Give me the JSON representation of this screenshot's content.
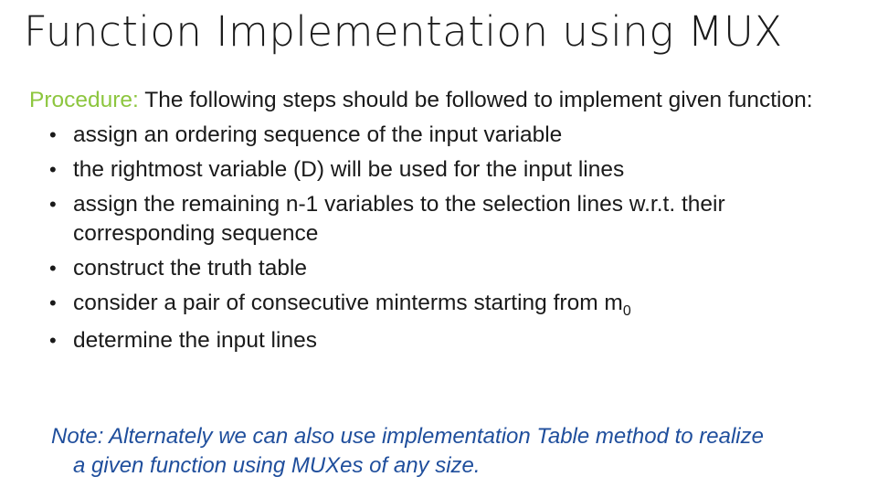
{
  "slide": {
    "title": "Function Implementation using MUX",
    "procedure_label": "Procedure:",
    "intro_text": " The following steps should be followed to implement given function:",
    "steps": [
      "assign an ordering sequence of the input variable",
      "the rightmost variable (D) will be used for the input lines",
      "assign the remaining n-1 variables to the selection lines w.r.t. their corresponding sequence",
      "construct the truth table",
      "consider a pair of consecutive minterms starting from m",
      "determine the input lines"
    ],
    "step5_subscript": "0",
    "note_line1": "Note: Alternately we can also use implementation Table method to realize",
    "note_line2": "a given function using MUXes of any size.",
    "colors": {
      "procedure": "#8dc63f",
      "note": "#1f4e9c",
      "text": "#1a1a1a"
    }
  }
}
